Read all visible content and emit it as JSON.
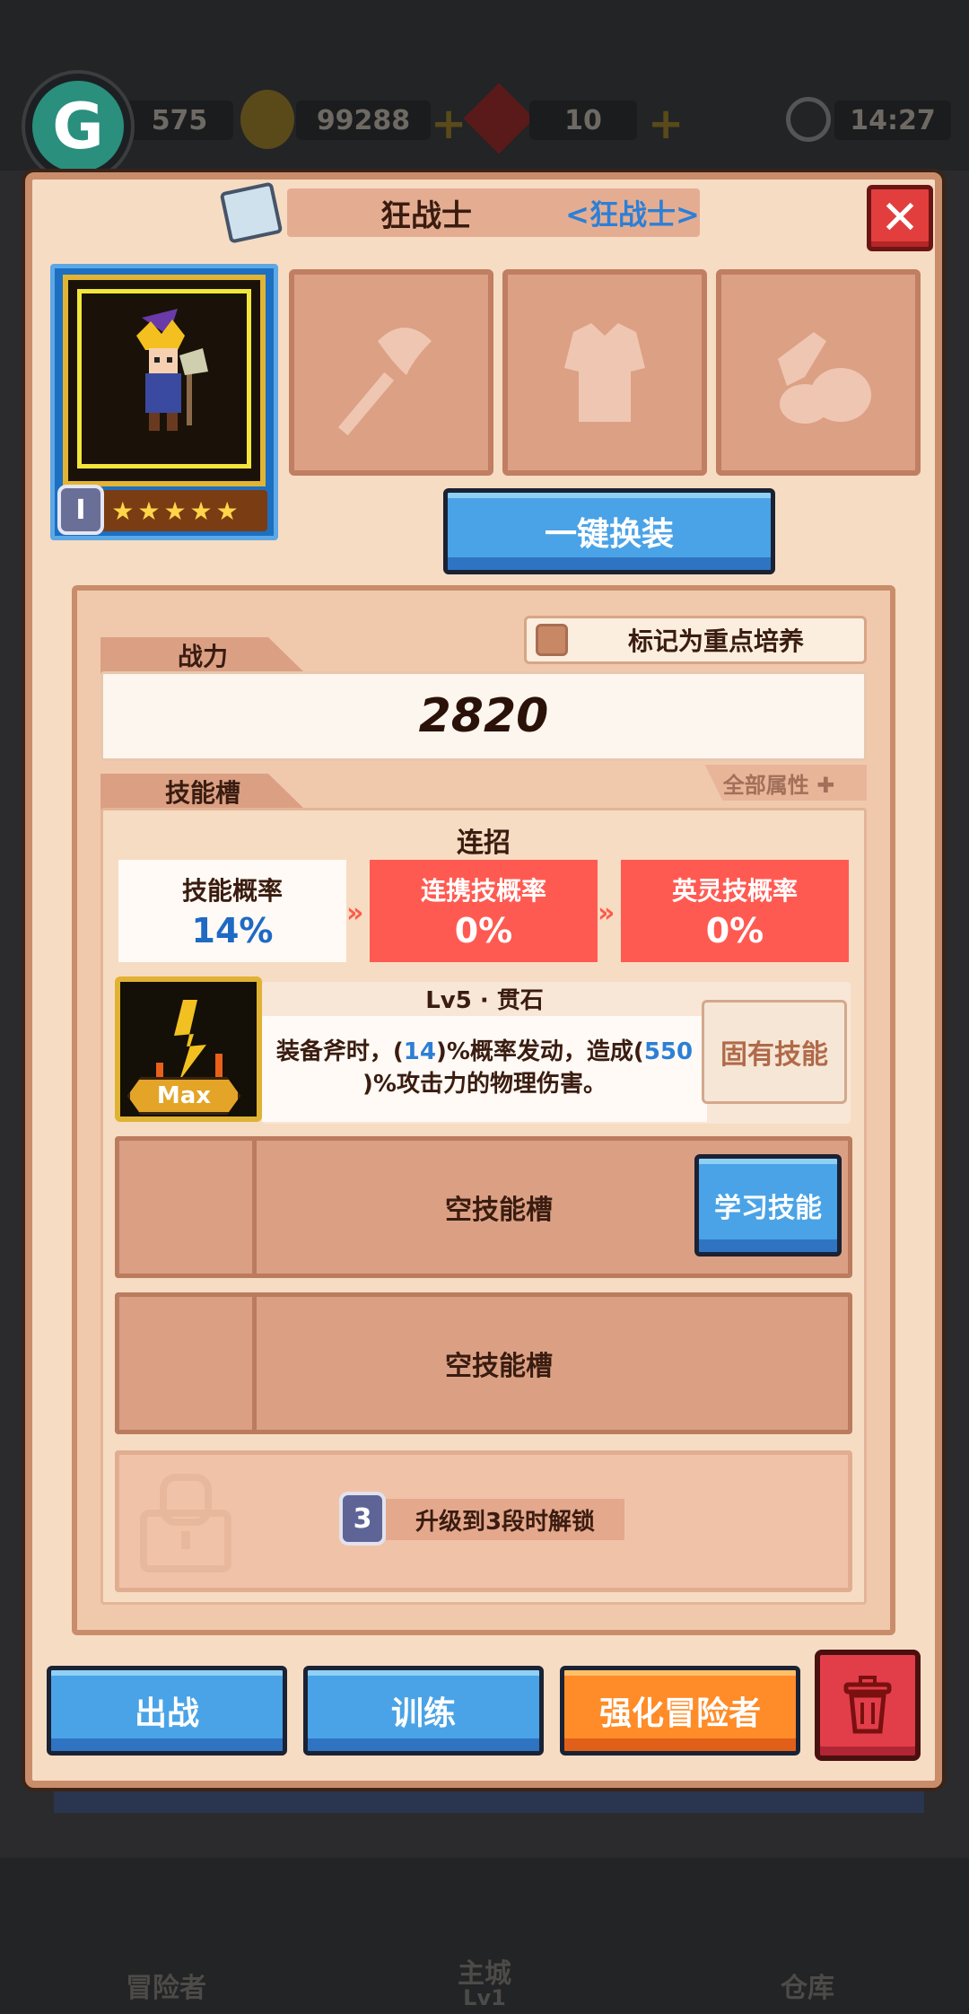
{
  "hud": {
    "gems": "575",
    "gold": "99288",
    "tickets": "10",
    "timer": "14:27",
    "g_button": "G"
  },
  "bottom_nav": {
    "adventurer": "冒险者",
    "main_city": "主城",
    "main_city_level": "Lv1",
    "warehouse": "仓库"
  },
  "panel": {
    "title": "狂战士",
    "subtitle": "<狂战士>",
    "close": "✕",
    "grade": "I",
    "stars": [
      "★",
      "★",
      "★",
      "★",
      "★"
    ],
    "equip_all_button": "一键换装",
    "mark_focus": "标记为重点培养",
    "power_tab": "战力",
    "power_value": "2820",
    "skill_slot_tab": "技能槽",
    "all_attributes": "全部属性 ✚",
    "combo_title": "连招",
    "rates": [
      {
        "label": "技能概率",
        "value": "14%"
      },
      {
        "label": "连携技概率",
        "value": "0%"
      },
      {
        "label": "英灵技概率",
        "value": "0%"
      }
    ],
    "skill": {
      "name": "Lv5 · 贯石",
      "desc_prefix": "装备斧时，(",
      "desc_num1": "14",
      "desc_mid": ")%概率发动，造成(",
      "desc_num2": "550",
      "desc_suffix": ")%攻击力的物理伤害。",
      "badge": "Max",
      "innate": "固有技能"
    },
    "empty_slot": "空技能槽",
    "learn_skill": "学习技能",
    "unlock_grade": "3",
    "unlock_text": "升级到3段时解锁",
    "buttons": {
      "battle": "出战",
      "train": "训练",
      "enhance": "强化冒险者"
    }
  },
  "colors": {
    "panel_bg": "#f6dcc2",
    "blue_button": "#4aa3e6",
    "orange_button": "#ff8c28",
    "red_rate": "#ff5a4a",
    "highlight_blue": "#2d7fd6"
  }
}
